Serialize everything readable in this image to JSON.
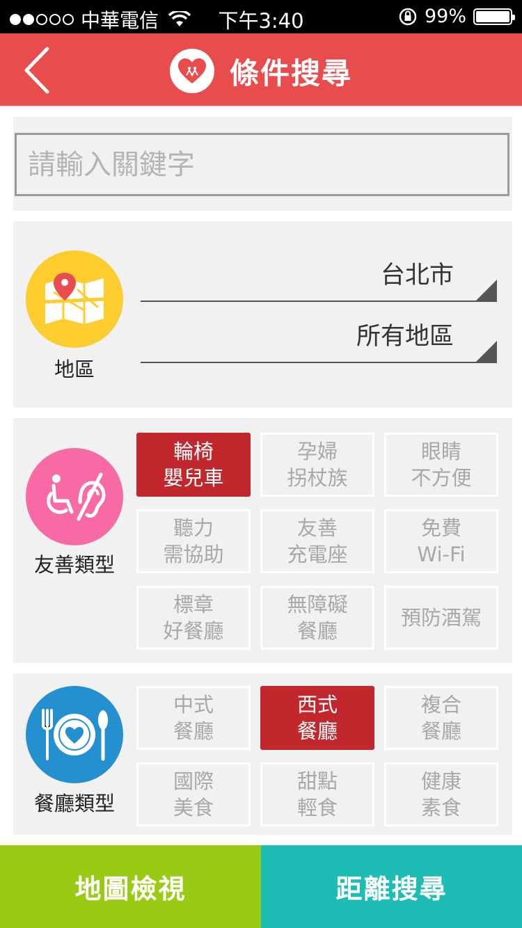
{
  "status_bar": {
    "carrier": "中華電信",
    "time": "下午3:40",
    "battery": "99%",
    "battery_level": 0.99,
    "signal_bars_on": 2,
    "signal_bars_total": 5
  },
  "header": {
    "title": "條件搜尋",
    "color": "#e84c4c"
  },
  "search": {
    "placeholder": "請輸入關鍵字",
    "value": ""
  },
  "region": {
    "label": "地區",
    "city": "台北市",
    "district": "所有地區",
    "icon": "map-pin-icon"
  },
  "friendly": {
    "label": "友善類型",
    "icon": "accessibility-icon",
    "options": [
      {
        "line1": "輪椅",
        "line2": "嬰兒車",
        "selected": true
      },
      {
        "line1": "孕婦",
        "line2": "拐杖族",
        "selected": false
      },
      {
        "line1": "眼睛",
        "line2": "不方便",
        "selected": false
      },
      {
        "line1": "聽力",
        "line2": "需協助",
        "selected": false
      },
      {
        "line1": "友善",
        "line2": "充電座",
        "selected": false
      },
      {
        "line1": "免費",
        "line2": "Wi-Fi",
        "selected": false
      },
      {
        "line1": "標章",
        "line2": "好餐廳",
        "selected": false
      },
      {
        "line1": "無障礙",
        "line2": "餐廳",
        "selected": false
      },
      {
        "line1": "預防酒駕",
        "line2": "",
        "selected": false
      }
    ]
  },
  "restaurant": {
    "label": "餐廳類型",
    "icon": "plate-cutlery-icon",
    "options": [
      {
        "line1": "中式",
        "line2": "餐廳",
        "selected": false
      },
      {
        "line1": "西式",
        "line2": "餐廳",
        "selected": true
      },
      {
        "line1": "複合",
        "line2": "餐廳",
        "selected": false
      },
      {
        "line1": "國際",
        "line2": "美食",
        "selected": false
      },
      {
        "line1": "甜點",
        "line2": "輕食",
        "selected": false
      },
      {
        "line1": "健康",
        "line2": "素食",
        "selected": false
      }
    ]
  },
  "bottom": {
    "map_view": "地圖檢視",
    "distance_search": "距離搜尋"
  },
  "colors": {
    "selected": "#c1272d",
    "map_button": "#9acb14",
    "distance_button": "#1dbcb4",
    "region_circle": "#fdcc2f",
    "friendly_circle": "#f76aa6",
    "restaurant_circle": "#2590cf"
  }
}
